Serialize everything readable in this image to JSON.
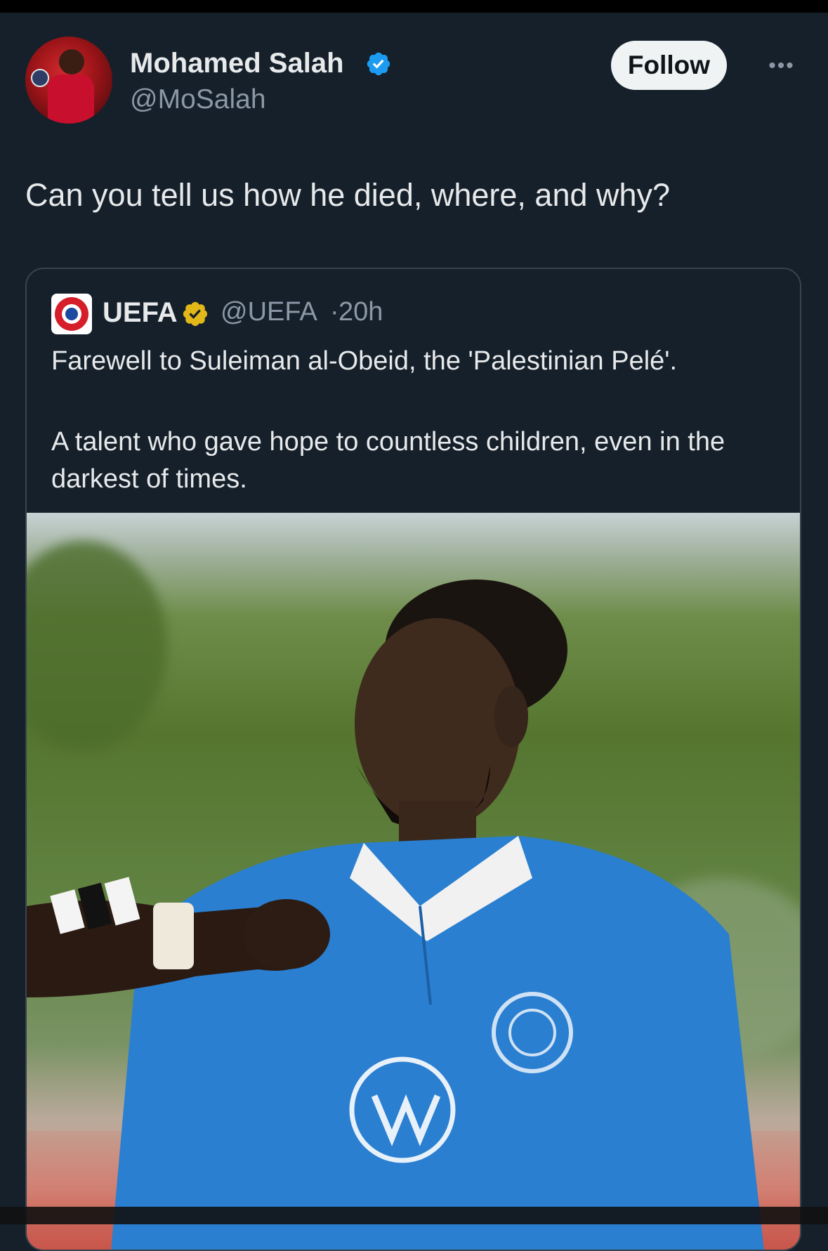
{
  "author": {
    "name": "Mohamed Salah",
    "handle": "@MoSalah",
    "verified": true
  },
  "actions": {
    "follow_label": "Follow",
    "more_icon": "more-horizontal-icon"
  },
  "tweet": {
    "text": "Can you tell us how he died, where, and why?"
  },
  "quoted": {
    "name": "UEFA",
    "handle": "@UEFA",
    "separator": "·",
    "time": "20h",
    "verified": true,
    "text_line1": "Farewell to Suleiman al-Obeid, the 'Palestinian Pelé'.",
    "text_paragraph2": "A talent who gave hope to countless children, even in the darkest of times.",
    "media": "photo"
  },
  "colors": {
    "background": "#15202b",
    "text": "#e7e9ea",
    "secondary_text": "#8b98a5",
    "verified_blue": "#1d9bf0",
    "verified_gold": "#e2b719",
    "border": "#38444d"
  }
}
